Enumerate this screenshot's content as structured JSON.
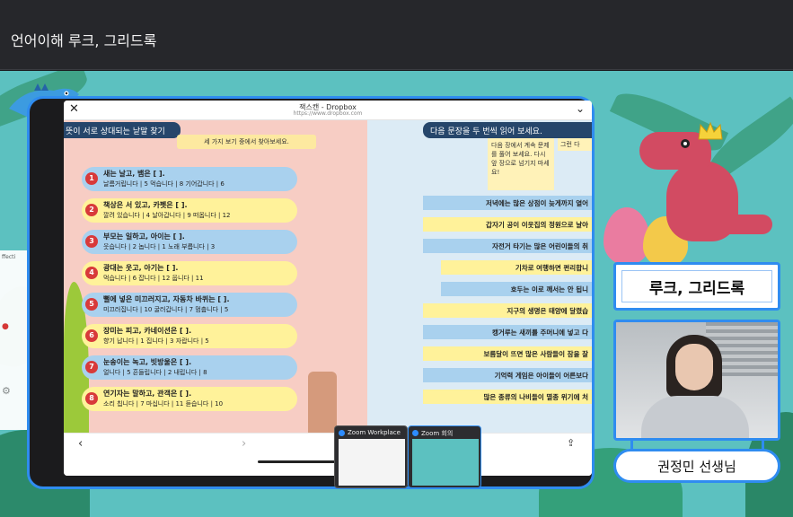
{
  "window": {
    "title": "언어이해 루크, 그리드록"
  },
  "scanner": {
    "title": "잭스캔 - Dropbox",
    "subtitle": "https://www.dropbox.com",
    "close_icon": "close-icon",
    "chevron_icon": "chevron-down-icon"
  },
  "left_page": {
    "heading": "뜻이 서로 상대되는 낱말 찾기",
    "subheading": "세 가지 보기 중에서 찾아보세요.",
    "questions": [
      {
        "num": "1",
        "sentence": "새는 날고, 뱀은 [ ].",
        "options": "날름거립니다 | 5   먹습니다 | 8   기어갑니다 | 6"
      },
      {
        "num": "2",
        "sentence": "책상은 서 있고, 카펫은 [ ].",
        "options": "깔려 있습니다 | 4   날아갑니다 | 9   떠옵니다 | 12"
      },
      {
        "num": "3",
        "sentence": "부모는 일하고, 아이는 [ ].",
        "options": "웃습니다 | 2   놉니다 | 1   노래 부릅니다 | 3"
      },
      {
        "num": "4",
        "sentence": "광대는 웃고, 아기는 [ ].",
        "options": "먹습니다 | 6   잡니다 | 12   웁니다 | 11"
      },
      {
        "num": "5",
        "sentence": "뻘에 넣은 미끄러지고, 자동차 바퀴는 [ ].",
        "options": "미끄러집니다 | 10   굴러갑니다 | 7   멈춥니다 | 5"
      },
      {
        "num": "6",
        "sentence": "장미는 피고, 카네이션은 [ ].",
        "options": "향기 납니다 | 1   집니다 | 3   자랍니다 | 5"
      },
      {
        "num": "7",
        "sentence": "눈송이는 녹고, 빗방울은 [ ].",
        "options": "얼니다 | 5   흔들립니다 | 2   내립니다 | 8"
      },
      {
        "num": "8",
        "sentence": "연기자는 말하고, 관객은 [ ].",
        "options": "소리 칩니다 | 7   마십니다 | 11   듣습니다 | 10"
      }
    ]
  },
  "right_page": {
    "heading": "다음 문장을 두 번씩 읽어 보세요.",
    "note": "다음 장에서 계속 문제를 풀어 보세요. 다시 앞 장으로 넘기지 마세요!",
    "note_side": "그런 다",
    "sentences": [
      "저녁에는 많은 상점이 늦게까지 열어",
      "갑자기 공이 이웃집의 정원으로 날아",
      "자전거 타기는 많은 어린이들의 취",
      "기차로 여행하면 편리합니",
      "호두는 이로 깨서는 안 됩니",
      "지구의 생명은 태양에 달렸습",
      "캥거루는 새끼를 주머니에 넣고 다",
      "보름달이 뜨면 많은 사람들이 잠을 잘",
      "기억력 게임은 아이들이 어른보다",
      "많은 종류의 나비들이 멸종 위기에 처"
    ]
  },
  "scanner_bottom": {
    "prev_icon": "chevron-left-icon",
    "next_icon": "chevron-right-icon",
    "share_icon": "share-icon"
  },
  "zoom_windows": [
    {
      "label": "Zoom Workplace"
    },
    {
      "label": "Zoom 회의"
    }
  ],
  "side_fragment": {
    "label": "ffecti"
  },
  "title_card": {
    "text": "루크, 그리드록"
  },
  "teacher_card": {
    "text": "권정민 선생님"
  },
  "colors": {
    "background": "#5cc1c0",
    "frame_blue": "#2f8cf0",
    "heading_navy": "#26466b",
    "question_badge": "#d83a3a",
    "dino": "#d24b62"
  }
}
